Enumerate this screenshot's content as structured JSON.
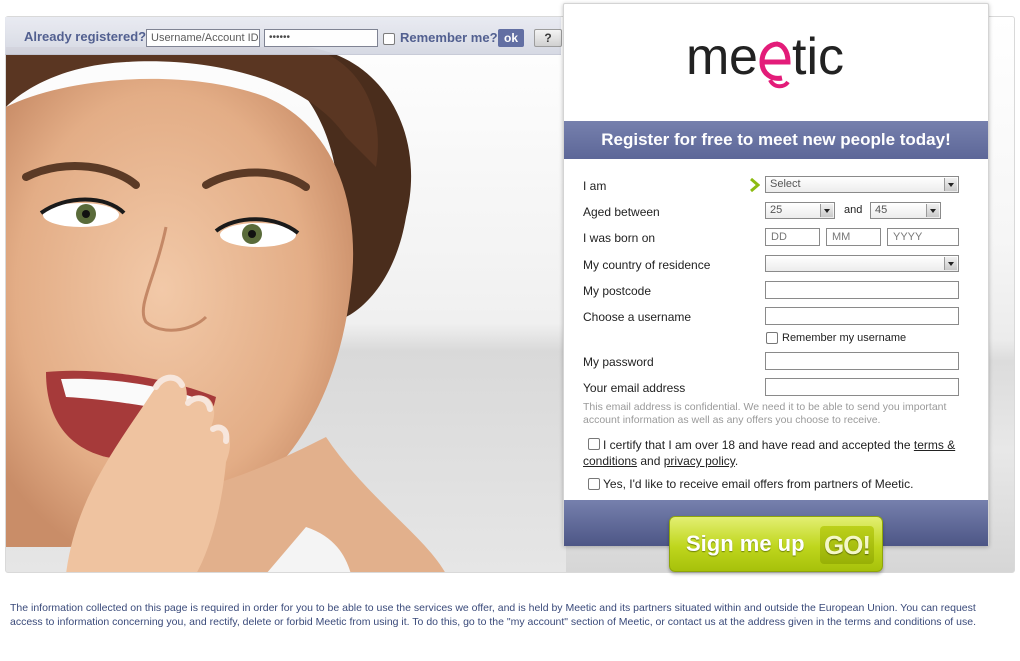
{
  "login_bar": {
    "label": "Already registered?",
    "username_value": "Username/Account ID",
    "password_value": "••••••",
    "remember_label": "Remember me?",
    "ok_label": "ok",
    "help_label": "?"
  },
  "brand": {
    "logo_text": "meetic",
    "accent_color": "#e31c79",
    "primary_color": "#5d6798",
    "cta_color": "#bfd61d"
  },
  "register": {
    "banner": "Register for free to meet new people today!",
    "fields": {
      "i_am": {
        "label": "I am",
        "value": "Select"
      },
      "aged_between": {
        "label": "Aged between",
        "min": "25",
        "and_label": "and",
        "max": "45"
      },
      "born_on": {
        "label": "I was born on",
        "dd_placeholder": "DD",
        "mm_placeholder": "MM",
        "yyyy_placeholder": "YYYY"
      },
      "country": {
        "label": "My country of residence",
        "value": ""
      },
      "postcode": {
        "label": "My postcode"
      },
      "username": {
        "label": "Choose a username",
        "remember_label": "Remember my username"
      },
      "password": {
        "label": "My password"
      },
      "email": {
        "label": "Your email address"
      }
    },
    "email_note": "This email address is confidential. We need it to be able to send you important account information as well as any offers you choose to receive.",
    "terms": {
      "prefix": "I certify that I am over 18 and have read and accepted the ",
      "terms_link": "terms & conditions",
      "and": " and ",
      "privacy_link": "privacy policy",
      "suffix": "."
    },
    "partners_label": "Yes, I'd like to receive email offers from partners of Meetic.",
    "signup_label": "Sign me up",
    "go_label": "GO!"
  },
  "disclaimer": "The information collected on this page is required in order for you to be able to use the services we offer, and is held by Meetic and its partners situated within and outside the European Union. You can request access to information concerning you, and rectify, delete or forbid Meetic from using it. To do this, go to the \"my account\" section of Meetic, or contact us at the address given in the terms and conditions of use."
}
